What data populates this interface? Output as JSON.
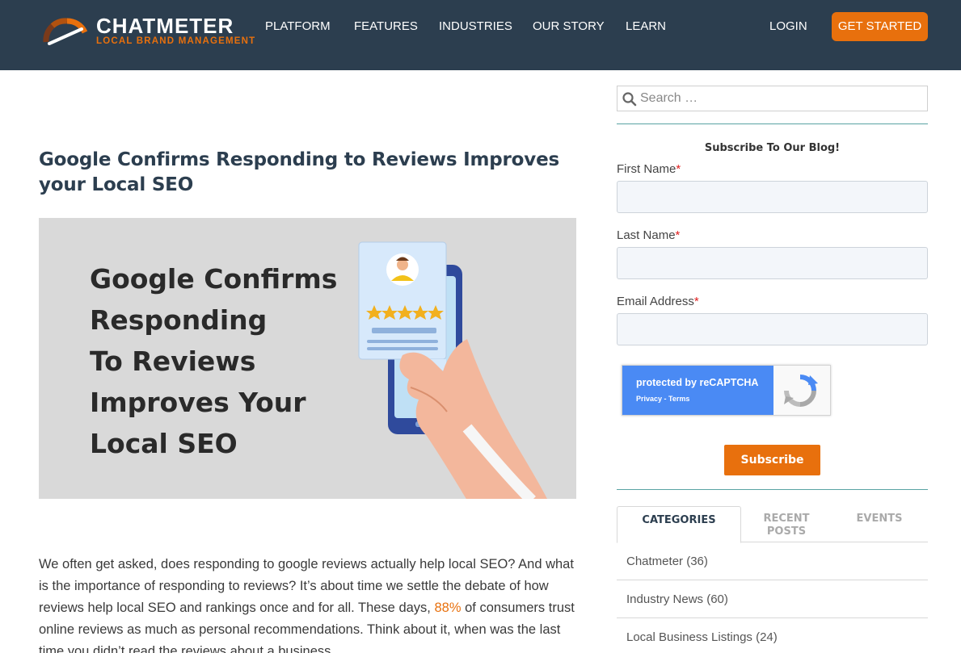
{
  "header": {
    "logo_word": "CHATMETER",
    "logo_tagline": "LOCAL BRAND MANAGEMENT",
    "nav": [
      "PLATFORM",
      "FEATURES",
      "INDUSTRIES",
      "OUR STORY",
      "LEARN"
    ],
    "login": "LOGIN",
    "cta": "GET STARTED"
  },
  "article": {
    "title": "Google Confirms Responding to Reviews Improves your Local SEO",
    "hero_lines": [
      "Google Confirms",
      "Responding",
      "To Reviews",
      "Improves Your",
      "Local SEO"
    ],
    "body_before_link": "We often get asked, does responding to google reviews actually help local SEO? And what is the importance of responding to reviews? It’s about time we settle the debate of how reviews help local SEO and rankings once and for all. These days,",
    "body_link": "88%",
    "body_after_link": "of consumers trust online reviews as much as personal recommendations. Think about it, when was the last time you didn’t read the reviews about a business"
  },
  "sidebar": {
    "search_placeholder": "Search …",
    "subscribe_heading": "Subscribe To Our Blog!",
    "fields": [
      {
        "label": "First Name",
        "required": "*"
      },
      {
        "label": "Last Name",
        "required": "*"
      },
      {
        "label": "Email Address",
        "required": "*"
      }
    ],
    "captcha_line1": "protected by reCAPTCHA",
    "captcha_line2": "Privacy - Terms",
    "subscribe_button": "Subscribe",
    "tabs": [
      "CATEGORIES",
      "RECENT POSTS",
      "EVENTS"
    ],
    "categories": [
      "Chatmeter (36)",
      "Industry News (60)",
      "Local Business Listings (24)"
    ]
  },
  "colors": {
    "header_bg": "#2c3e4f",
    "accent": "#e8700d",
    "divider": "#5aa3a3"
  }
}
